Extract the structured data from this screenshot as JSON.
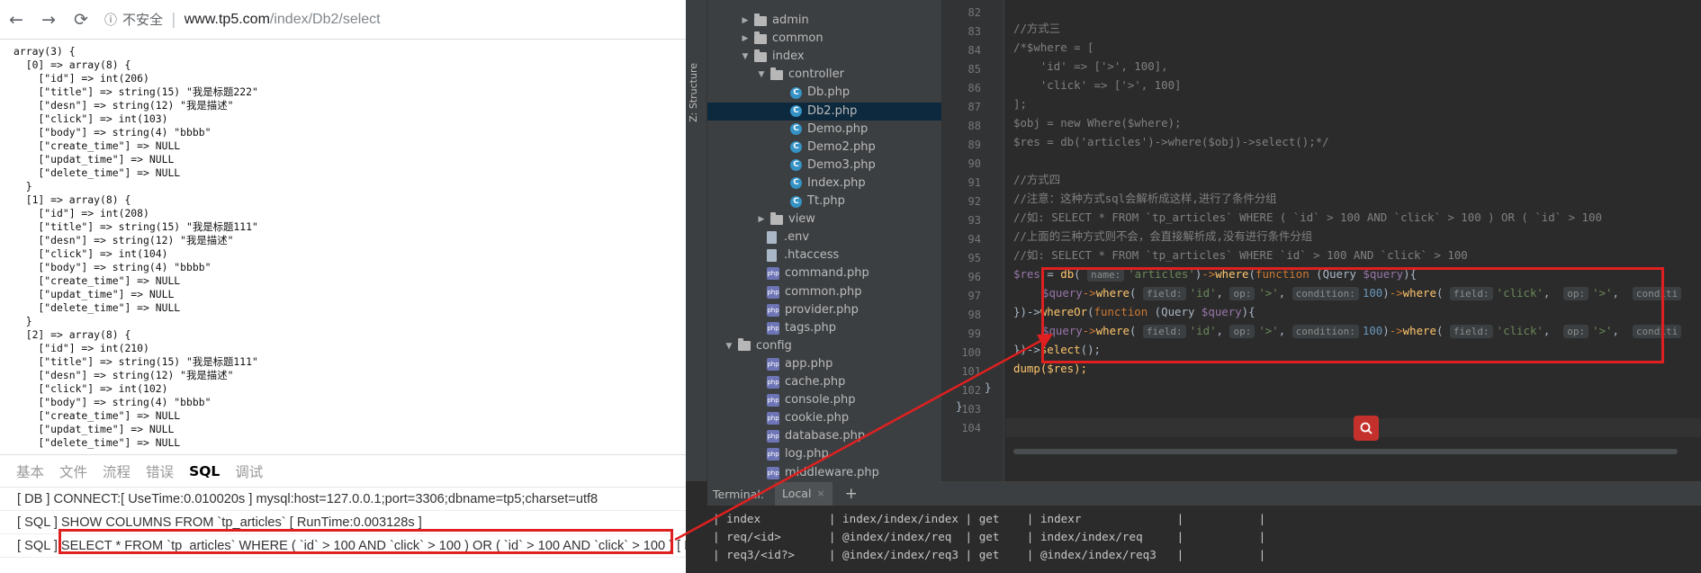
{
  "browser": {
    "back_icon": "arrow-left-icon",
    "forward_icon": "arrow-right-icon",
    "reload_icon": "reload-icon",
    "insecure_label": "不安全",
    "url_host": "www.tp5.com",
    "url_path": "/index/Db2/select",
    "dump_text": "array(3) {\n  [0] => array(8) {\n    [\"id\"] => int(206)\n    [\"title\"] => string(15) \"我是标题222\"\n    [\"desn\"] => string(12) \"我是描述\"\n    [\"click\"] => int(103)\n    [\"body\"] => string(4) \"bbbb\"\n    [\"create_time\"] => NULL\n    [\"updat_time\"] => NULL\n    [\"delete_time\"] => NULL\n  }\n  [1] => array(8) {\n    [\"id\"] => int(208)\n    [\"title\"] => string(15) \"我是标题111\"\n    [\"desn\"] => string(12) \"我是描述\"\n    [\"click\"] => int(104)\n    [\"body\"] => string(4) \"bbbb\"\n    [\"create_time\"] => NULL\n    [\"updat_time\"] => NULL\n    [\"delete_time\"] => NULL\n  }\n  [2] => array(8) {\n    [\"id\"] => int(210)\n    [\"title\"] => string(15) \"我是标题111\"\n    [\"desn\"] => string(12) \"我是描述\"\n    [\"click\"] => int(102)\n    [\"body\"] => string(4) \"bbbb\"\n    [\"create_time\"] => NULL\n    [\"updat_time\"] => NULL\n    [\"delete_time\"] => NULL",
    "trace_tabs": [
      "基本",
      "文件",
      "流程",
      "错误",
      "SQL",
      "调试"
    ],
    "active_trace_tab": "SQL",
    "trace_lines": [
      "[ DB ] CONNECT:[ UseTime:0.010020s ] mysql:host=127.0.0.1;port=3306;dbname=tp5;charset=utf8",
      "[ SQL ] SHOW COLUMNS FROM `tp_articles` [ RunTime:0.003128s ]",
      "[ SQL ] SELECT * FROM `tp_articles` WHERE ( `id` > 100 AND `click` > 100 ) OR ( `id` > 100 AND `click` > 100 ) [ R"
    ]
  },
  "ide": {
    "structure_label": "Z: Structure",
    "tree": [
      {
        "label": "admin",
        "kind": "folder",
        "arrow": "▶"
      },
      {
        "label": "common",
        "kind": "folder",
        "arrow": "▶"
      },
      {
        "label": "index",
        "kind": "folder",
        "arrow": "▼"
      },
      {
        "label": "controller",
        "kind": "folder",
        "arrow": "▼"
      },
      {
        "label": "Db.php",
        "kind": "class"
      },
      {
        "label": "Db2.php",
        "kind": "class"
      },
      {
        "label": "Demo.php",
        "kind": "class"
      },
      {
        "label": "Demo2.php",
        "kind": "class"
      },
      {
        "label": "Demo3.php",
        "kind": "class"
      },
      {
        "label": "Index.php",
        "kind": "class"
      },
      {
        "label": "Tt.php",
        "kind": "class"
      },
      {
        "label": "view",
        "kind": "folder",
        "arrow": "▶"
      },
      {
        "label": ".env",
        "kind": "plain"
      },
      {
        "label": ".htaccess",
        "kind": "plain"
      },
      {
        "label": "command.php",
        "kind": "php"
      },
      {
        "label": "common.php",
        "kind": "php"
      },
      {
        "label": "provider.php",
        "kind": "php"
      },
      {
        "label": "tags.php",
        "kind": "php"
      },
      {
        "label": "config",
        "kind": "folder",
        "arrow": "▼"
      },
      {
        "label": "app.php",
        "kind": "php"
      },
      {
        "label": "cache.php",
        "kind": "php"
      },
      {
        "label": "console.php",
        "kind": "php"
      },
      {
        "label": "cookie.php",
        "kind": "php"
      },
      {
        "label": "database.php",
        "kind": "php"
      },
      {
        "label": "log.php",
        "kind": "php"
      },
      {
        "label": "middleware.php",
        "kind": "php"
      }
    ],
    "line_numbers": [
      "82",
      "83",
      "84",
      "85",
      "86",
      "87",
      "88",
      "89",
      "90",
      "91",
      "92",
      "93",
      "94",
      "95",
      "96",
      "97",
      "98",
      "99",
      "100",
      "101",
      "102",
      "103",
      "104"
    ],
    "code": {
      "l83": "//方式三",
      "l84": "/*$where = [",
      "l85": "    'id' => ['>', 100],",
      "l86": "    'click' => ['>', 100]",
      "l87": "];",
      "l88": "$obj = new Where($where);",
      "l89": "$res = db('articles')->where($obj)->select();*/",
      "l91": "//方式四",
      "l92": "//注意：这种方式sql会解析成这样,进行了条件分组",
      "l93": "//如: SELECT * FROM `tp_articles` WHERE ( `id` > 100 AND `click` > 100 ) OR ( `id` > 100",
      "l94": "//上面的三种方式则不会，会直接解析成,没有进行条件分组",
      "l95": "//如: SELECT * FROM `tp_articles` WHERE `id` > 100 AND `click` > 100",
      "l101": "dump($res);",
      "l102": "}",
      "l103": "}"
    },
    "code_tokens": {
      "res": "$res",
      "eq": " = ",
      "db": "db",
      "open": "(",
      "hint_name": "name:",
      "articles": "'articles'",
      "close": ")",
      "arrow_where": "->",
      "where": "where",
      "function_kw": "function",
      "query_class": " (Query ",
      "query_var": "$query",
      "close_brace_open": "){",
      "hint_field": "field:",
      "id_str": "'id'",
      "comma": ", ",
      "hint_op": "op:",
      "gt_str": "'>'",
      "hint_condition": "condition:",
      "hundred": "100",
      "click_str": "'click'",
      "hint_conditi": "conditi",
      "whereor": "whereOr",
      "brace_close_arrow": "})->",
      "select": "select",
      "select_tail": "();",
      "close_paren": ")"
    },
    "terminal": {
      "title": "Terminal:",
      "tab_label": "Local",
      "close_icon": "close-icon",
      "add_icon": "plus-icon",
      "rows": [
        "| index          | index/index/index | get    | indexr              |           |",
        "| req/<id>       | @index/index/req  | get    | index/index/req     |           |",
        "| req3/<id?>     | @index/index/req3 | get    | @index/index/req3   |           |"
      ]
    },
    "search_icon": "search-icon"
  },
  "colors": {
    "highlight_border": "#e02020",
    "ide_background": "#2b2b2b",
    "keyword": "#cc7832",
    "string": "#6a8759",
    "number": "#6897bb",
    "variable": "#9876aa",
    "function": "#ffc66d"
  }
}
